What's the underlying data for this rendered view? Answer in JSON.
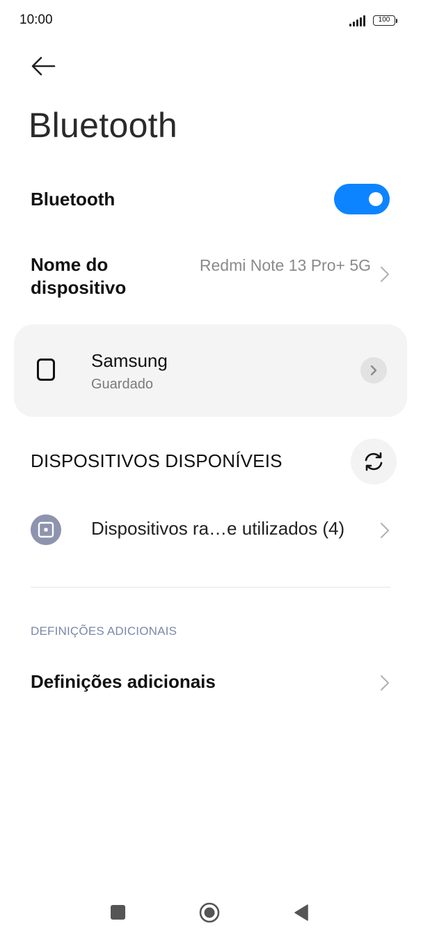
{
  "status_bar": {
    "time": "10:00",
    "battery": "100",
    "icons": [
      "signal-icon",
      "battery-icon"
    ]
  },
  "header": {
    "back_icon": "arrow-left-icon",
    "title": "Bluetooth"
  },
  "bluetooth_toggle": {
    "label": "Bluetooth",
    "enabled": true,
    "accent_color": "#0d84ff"
  },
  "device_name": {
    "label": "Nome do dispositivo",
    "value": "Redmi Note 13 Pro+ 5G",
    "icon": "chevron-right-icon"
  },
  "saved_devices": [
    {
      "name": "Samsung",
      "status": "Guardado",
      "icon": "device-icon",
      "action_icon": "chevron-right-icon"
    }
  ],
  "available_devices": {
    "title": "DISPOSITIVOS DISPONÍVEIS",
    "refresh_icon": "refresh-icon",
    "recent": {
      "label": "Dispositivos ra…e utilizados (4)",
      "icon": "device-icon",
      "icon_color": "#8e94ad"
    }
  },
  "additional": {
    "section_label": "DEFINIÇÕES ADICIONAIS",
    "item_label": "Definições adicionais"
  },
  "nav_bar": {
    "icons": [
      "recents-icon",
      "home-icon",
      "back-icon"
    ]
  }
}
